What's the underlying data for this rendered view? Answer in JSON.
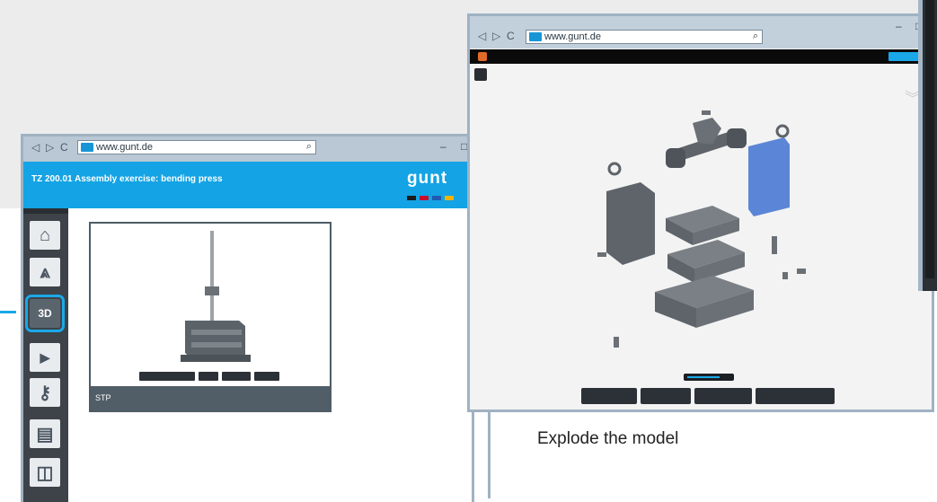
{
  "left_window": {
    "browser": {
      "back": "◁",
      "forward": "▷",
      "reload": "C",
      "url": "www.gunt.de",
      "search_icon": "⌕",
      "minimize": "–",
      "maximize": "□"
    },
    "app_title": "TZ 200.01 Assembly exercise: bending press",
    "logo_text": "gunt",
    "flag_colors": [
      "#1b1b1b",
      "#c8102e",
      "#1f5bb3",
      "#f0b400"
    ],
    "sidebar": [
      {
        "name": "home-icon",
        "glyph": "⌂",
        "label": ""
      },
      {
        "name": "drawing-compass-icon",
        "glyph": "⩓",
        "label": ""
      },
      {
        "name": "3d-view-icon",
        "glyph": "",
        "label": "3D"
      },
      {
        "name": "play-icon",
        "glyph": "▶",
        "label": ""
      },
      {
        "name": "assembly-icon",
        "glyph": "⚷",
        "label": ""
      },
      {
        "name": "document-icon",
        "glyph": "▤",
        "label": ""
      },
      {
        "name": "panel-icon",
        "glyph": "◫",
        "label": ""
      }
    ],
    "card_label": "STP"
  },
  "right_window": {
    "browser": {
      "back": "◁",
      "forward": "▷",
      "reload": "C",
      "url": "www.gunt.de",
      "search_icon": "⌕",
      "minimize": "–",
      "maximize": "□"
    },
    "explode_level": 0.75
  },
  "caption": "Explode the model",
  "colors": {
    "accent": "#1aa8e8",
    "header": "#14a3e4",
    "frame": "#9fb2c2",
    "sidebar": "#3d4349",
    "highlight_part": "#5b85d6"
  }
}
